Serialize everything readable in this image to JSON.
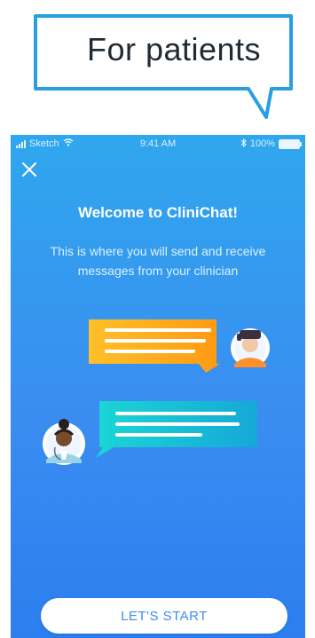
{
  "callout": {
    "label": "For patients"
  },
  "status_bar": {
    "carrier": "Sketch",
    "time": "9:41 AM",
    "battery": "100%"
  },
  "header": {
    "close_icon": "close-icon"
  },
  "welcome": {
    "title": "Welcome to CliniChat!",
    "subtitle": "This is where you will send and receive messages from your clinician"
  },
  "illustration": {
    "patient_avatar_icon": "patient-avatar-icon",
    "clinician_avatar_icon": "clinician-avatar-icon",
    "patient_bubble_color": "#ffb020",
    "clinician_bubble_color": "#1ec5d5"
  },
  "cta": {
    "label": "LET'S START"
  },
  "colors": {
    "background_top": "#2fa7ee",
    "background_bottom": "#2b7fef",
    "accent": "#3b8ff0",
    "callout_border": "#2a9fe0"
  }
}
